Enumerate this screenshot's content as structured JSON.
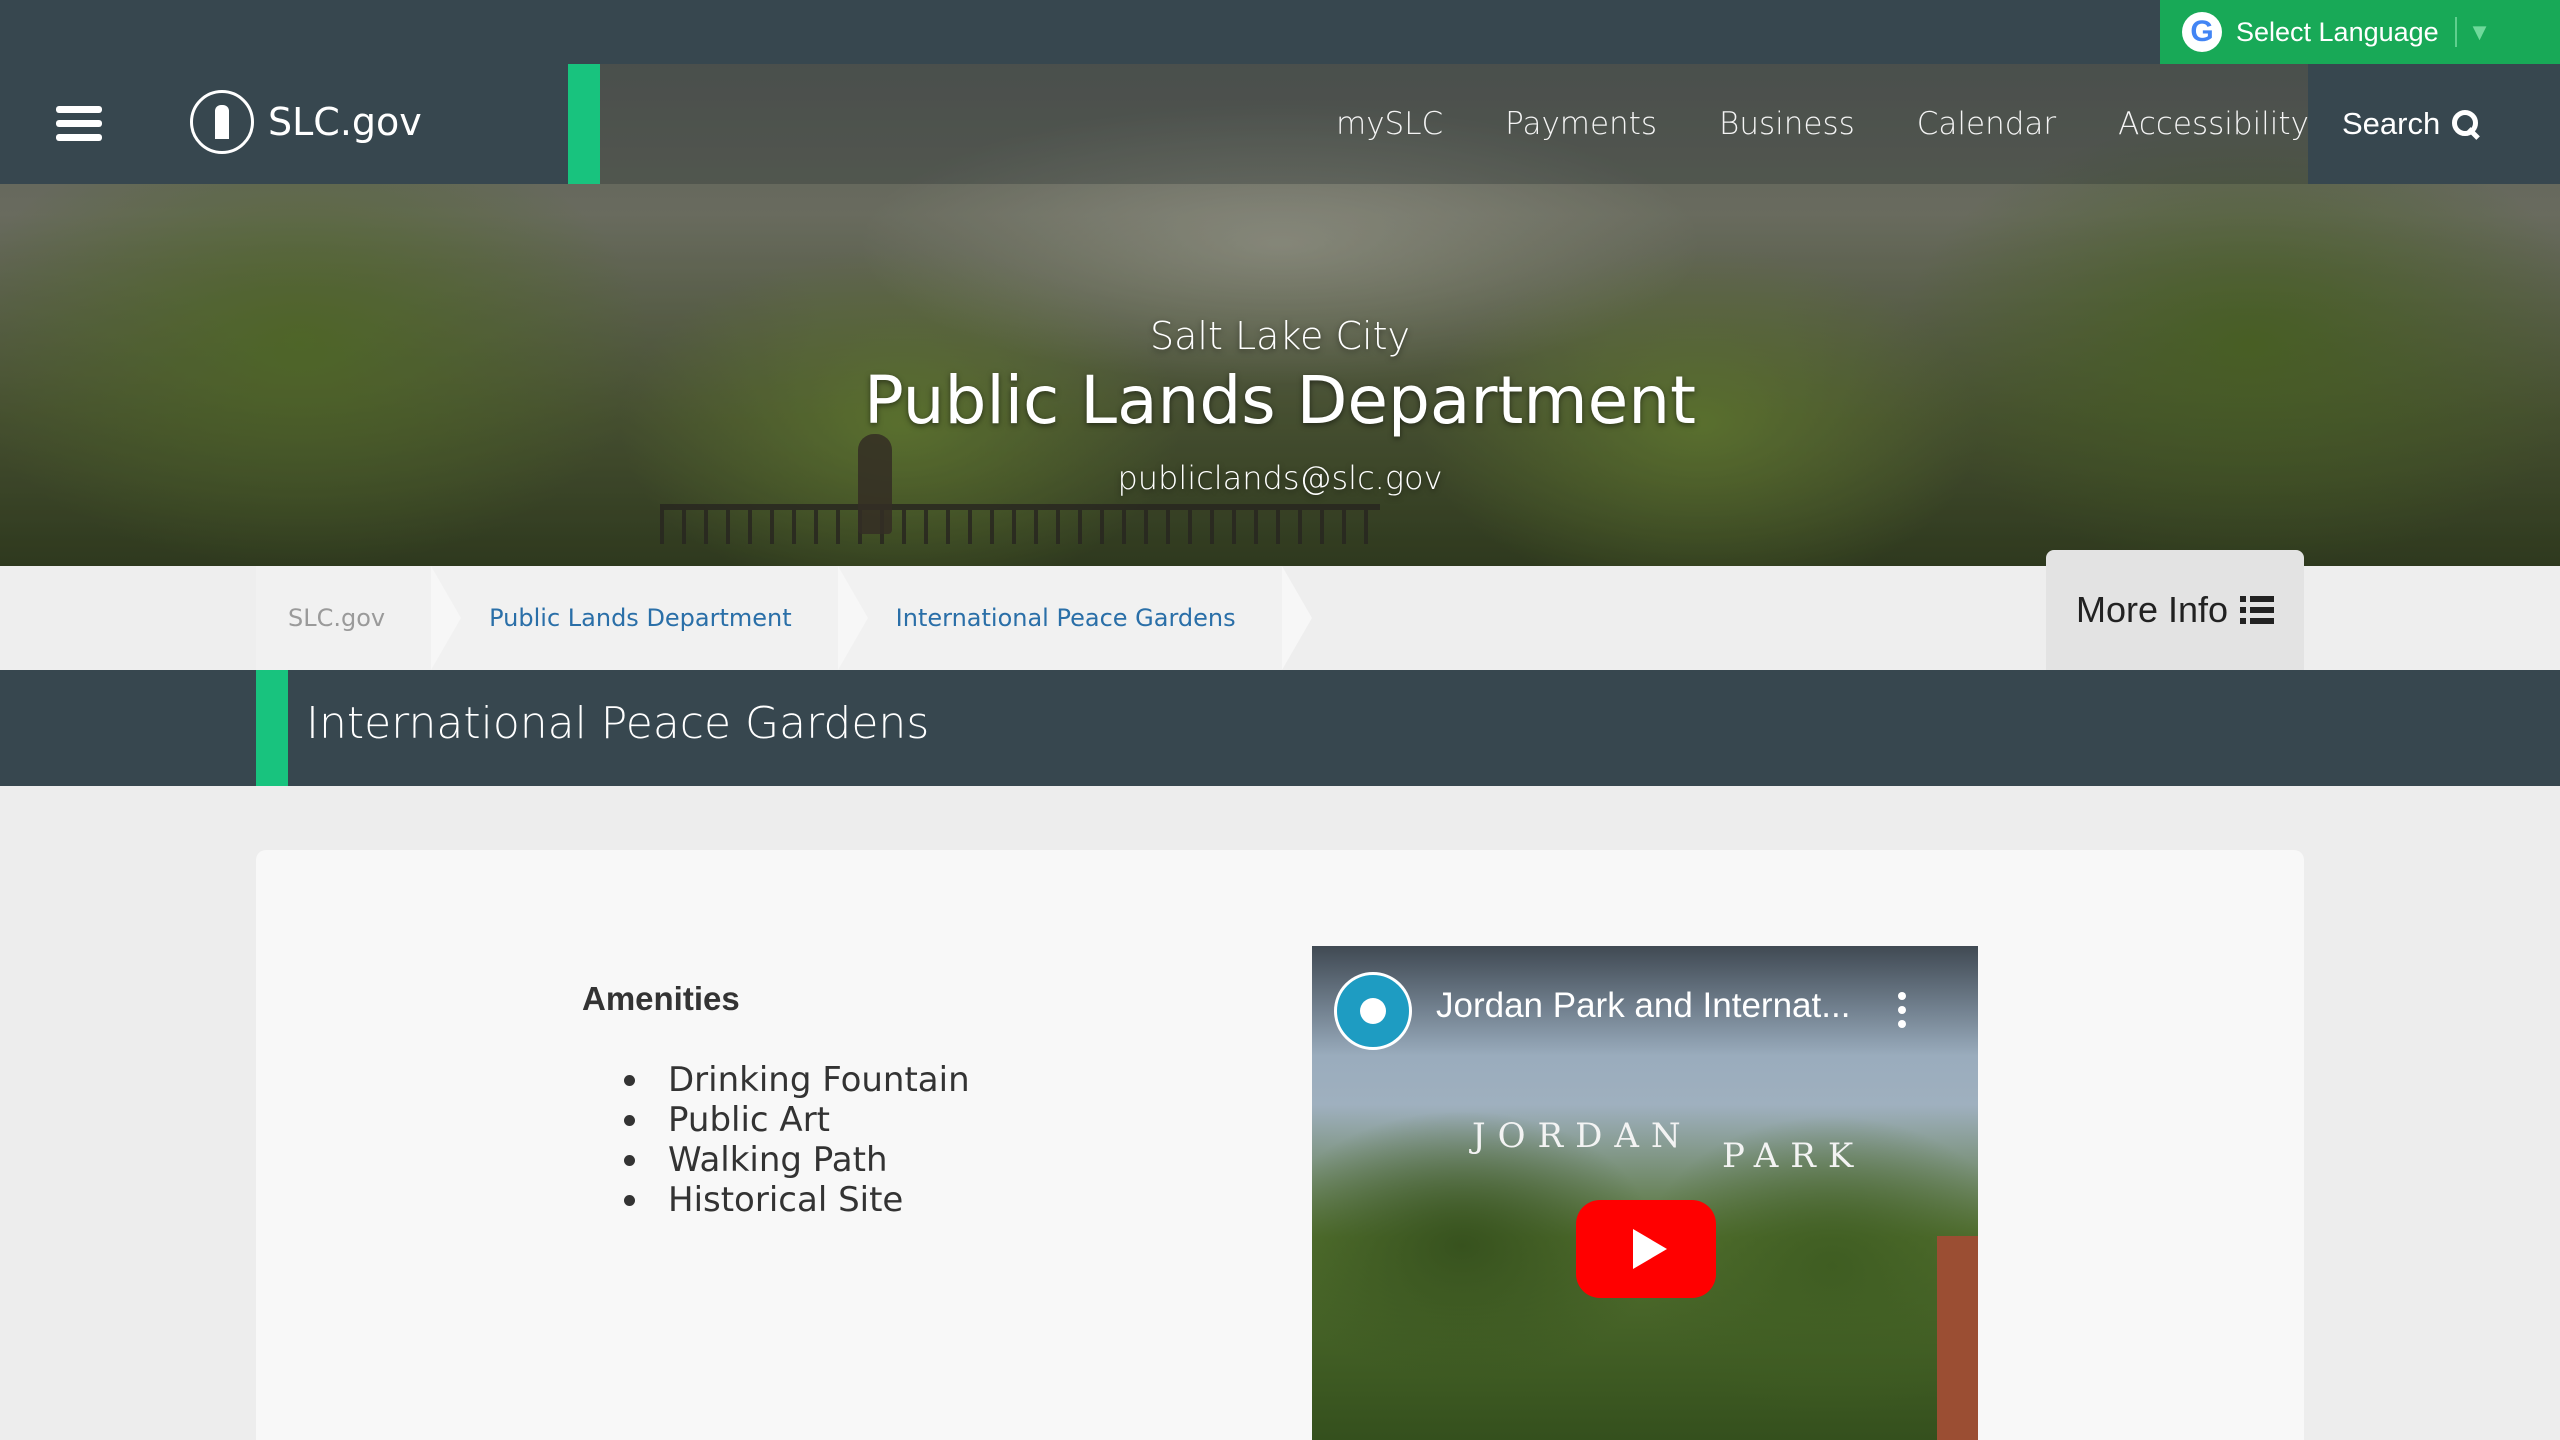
{
  "translate": {
    "label": "Select Language",
    "google_letter": "G"
  },
  "header": {
    "brand": "SLC.gov",
    "nav": [
      "mySLC",
      "Payments",
      "Business",
      "Calendar",
      "Accessibility"
    ],
    "search_label": "Search"
  },
  "hero": {
    "subtitle": "Salt Lake City",
    "title": "Public Lands Department",
    "email": "publiclands@slc.gov"
  },
  "breadcrumb": [
    "SLC.gov",
    "Public Lands Department",
    "International Peace Gardens"
  ],
  "more_info_label": "More Info",
  "page_title": "International Peace Gardens",
  "amenities": {
    "heading": "Amenities",
    "items": [
      "Drinking Fountain",
      "Public Art",
      "Walking Path",
      "Historical Site"
    ]
  },
  "video": {
    "title": "Jordan Park and Internat..."
  },
  "colors": {
    "header_bg": "#37474f",
    "accent_green": "#18c37e",
    "translate_green": "#18a957",
    "link_blue": "#2a6fa8",
    "play_red": "#ff0000"
  }
}
